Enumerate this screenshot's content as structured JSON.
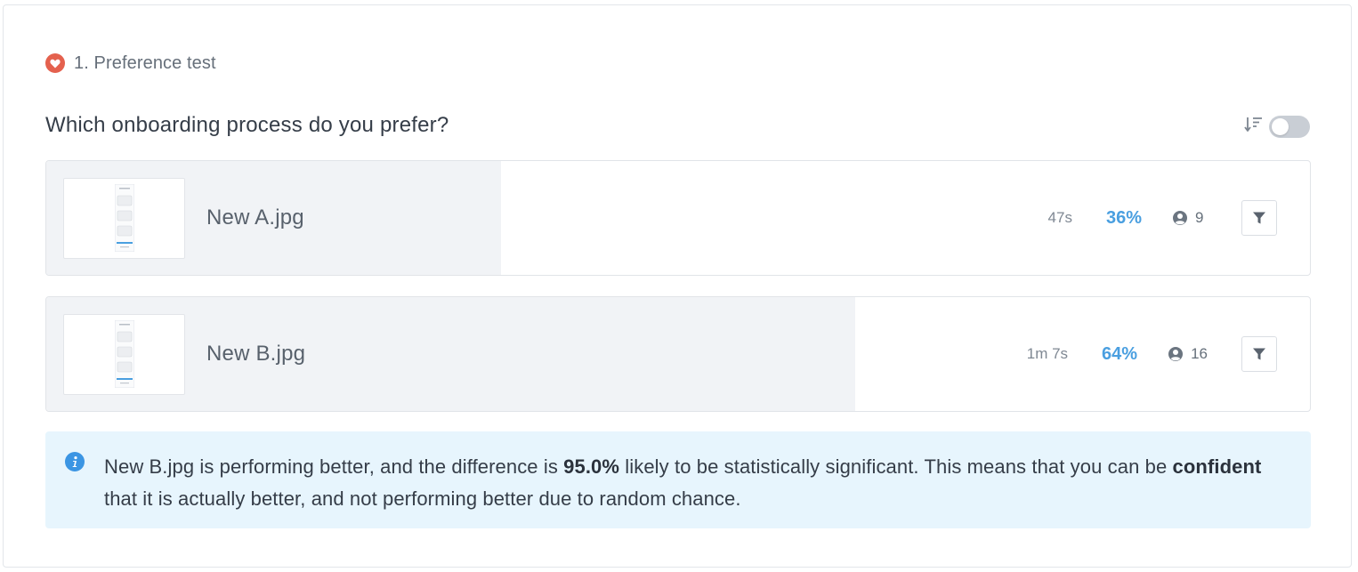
{
  "section": {
    "title": "1. Preference test",
    "icon": "heart-icon",
    "icon_color": "#e4614e"
  },
  "question": "Which onboarding process do you prefer?",
  "controls": {
    "sort_icon": "sort-descending-icon",
    "toggle_on": false
  },
  "options": [
    {
      "name": "New A.jpg",
      "time": "47s",
      "percent_label": "36%",
      "share": 0.36,
      "respondents": "9"
    },
    {
      "name": "New B.jpg",
      "time": "1m 7s",
      "percent_label": "64%",
      "share": 0.64,
      "respondents": "16"
    }
  ],
  "info": {
    "part1": "New B.jpg is performing better, and the difference is ",
    "bold1": "95.0%",
    "part2": " likely to be statistically significant. This means that you can be ",
    "bold2": "confident",
    "part3": " that it is actually better, and not performing better due to random chance."
  },
  "colors": {
    "accent_blue": "#4a9fe0",
    "info_background": "#e7f5fd",
    "info_icon": "#3b95e3",
    "bar_fill": "#f1f3f6"
  }
}
